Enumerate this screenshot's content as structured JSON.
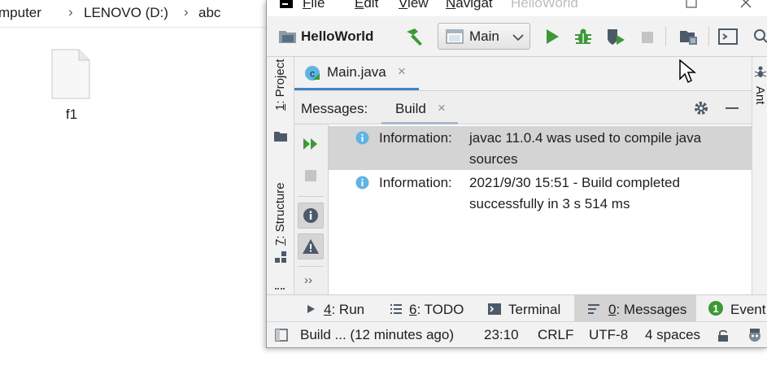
{
  "explorer": {
    "breadcrumb": [
      "mputer",
      "LENOVO (D:)",
      "abc"
    ],
    "separator": "›",
    "file_name": "f1"
  },
  "ide": {
    "menu": [
      {
        "mnemonic": "F",
        "rest": "ile"
      },
      {
        "mnemonic": "E",
        "rest": "dit"
      },
      {
        "mnemonic": "V",
        "rest": "iew"
      },
      {
        "mnemonic": "N",
        "rest": "avigat"
      }
    ],
    "window_title": "HelloWorld",
    "toolbar": {
      "project_name": "HelloWorld",
      "run_config": "Main"
    },
    "left_stripe": {
      "project": {
        "mnemonic": "1",
        "rest": ": Project"
      },
      "structure": {
        "mnemonic": "7",
        "rest": ": Structure"
      }
    },
    "right_stripe": {
      "label": "Ant"
    },
    "editor_tab": {
      "label": "Main.java",
      "close": "×"
    },
    "messages_panel": {
      "title": "Messages:",
      "tab": "Build",
      "tab_close": "×",
      "more": "››",
      "items": [
        {
          "type": "Information:",
          "text": "javac 11.0.4 was used to compile java sources"
        },
        {
          "type": "Information:",
          "text": "2021/9/30 15:51 - Build completed successfully in 3 s 514 ms"
        }
      ]
    },
    "bottom_tabs": [
      {
        "mnemonic": "4",
        "rest": ": Run"
      },
      {
        "mnemonic": "6",
        "rest": ": TODO"
      },
      {
        "label": "Terminal"
      },
      {
        "mnemonic": "0",
        "rest": ": Messages"
      },
      {
        "label": "Event"
      }
    ],
    "status": {
      "message": "Build ... (12 minutes ago)",
      "position": "23:10",
      "line_sep": "CRLF",
      "encoding": "UTF-8",
      "indent": "4 spaces"
    }
  },
  "colors": {
    "accent": "#4083c9",
    "run_green": "#3b9a36",
    "info_blue": "#5fb3e6"
  }
}
